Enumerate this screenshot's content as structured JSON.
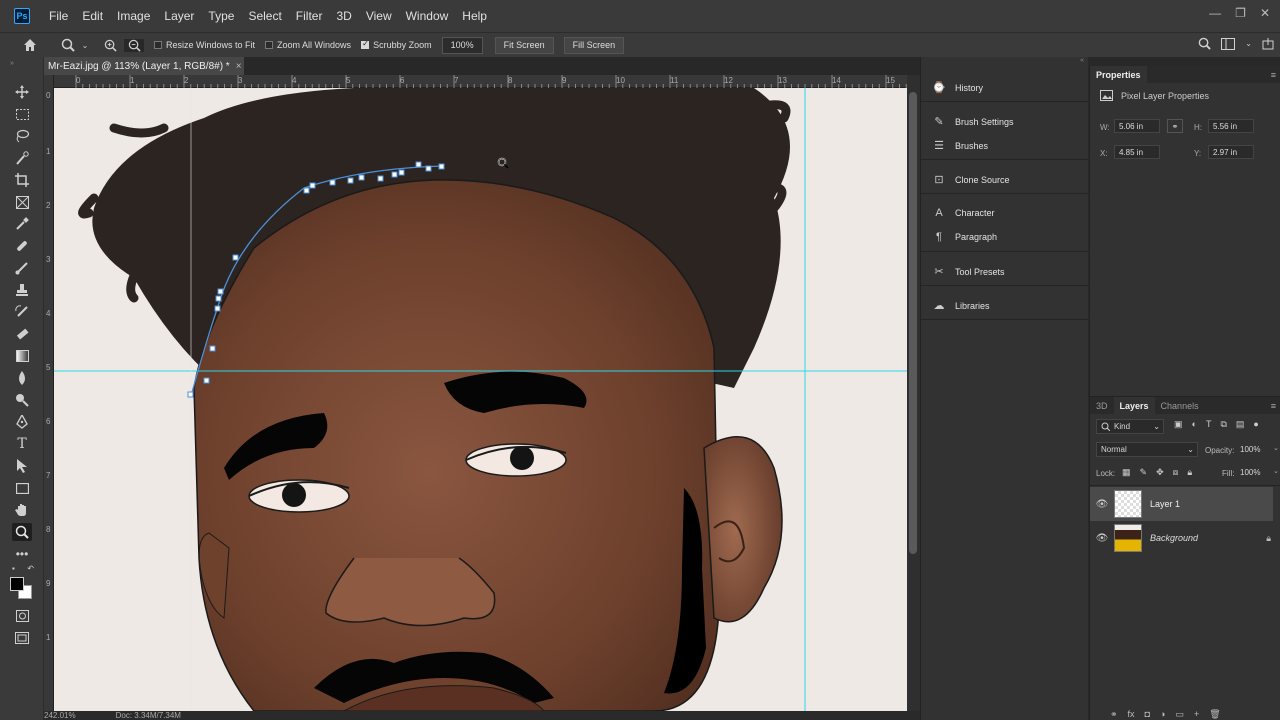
{
  "menu": {
    "logo": "Ps",
    "items": [
      "File",
      "Edit",
      "Image",
      "Layer",
      "Type",
      "Select",
      "Filter",
      "3D",
      "View",
      "Window",
      "Help"
    ],
    "window_controls": [
      "—",
      "❐",
      "✕"
    ]
  },
  "options": {
    "resize_windows_label": "Resize Windows to Fit",
    "resize_windows_checked": false,
    "zoom_all_label": "Zoom All Windows",
    "zoom_all_checked": false,
    "scrubby_zoom_label": "Scrubby Zoom",
    "scrubby_zoom_checked": true,
    "zoom_value": "100%",
    "fit_screen_label": "Fit Screen",
    "fill_screen_label": "Fill Screen"
  },
  "document": {
    "tab_title": "Mr-Eazi.jpg @ 113% (Layer 1, RGB/8#) *",
    "tab_close": "×",
    "h_ruler_labels": [
      "0",
      "1",
      "2",
      "3",
      "4",
      "5",
      "6",
      "7",
      "8",
      "9",
      "10",
      "11",
      "12",
      "13",
      "14",
      "15"
    ],
    "v_ruler_labels": [
      "0",
      "1",
      "2",
      "3",
      "4",
      "5",
      "6",
      "7",
      "8",
      "9",
      "1"
    ],
    "zoom_status": "242.01%",
    "doc_status": "Doc: 3.34M/7.34M"
  },
  "collapsed_panels": [
    {
      "icon": "history-icon",
      "glyph": "⌚",
      "label": "History"
    },
    {
      "icon": "brush-settings-icon",
      "glyph": "✎",
      "label": "Brush Settings"
    },
    {
      "icon": "brushes-icon",
      "glyph": "☰",
      "label": "Brushes"
    },
    {
      "icon": "clone-source-icon",
      "glyph": "⊡",
      "label": "Clone Source"
    },
    {
      "icon": "character-icon",
      "glyph": "A",
      "label": "Character"
    },
    {
      "icon": "paragraph-icon",
      "glyph": "¶",
      "label": "Paragraph"
    },
    {
      "icon": "tool-presets-icon",
      "glyph": "✂",
      "label": "Tool Presets"
    },
    {
      "icon": "libraries-icon",
      "glyph": "☁",
      "label": "Libraries"
    }
  ],
  "properties": {
    "tab": "Properties",
    "section": "Pixel Layer Properties",
    "w_label": "W:",
    "w_value": "5.06 in",
    "h_label": "H:",
    "h_value": "5.56 in",
    "x_label": "X:",
    "x_value": "4.85 in",
    "y_label": "Y:",
    "y_value": "2.97 in"
  },
  "layers_panel": {
    "tabs": [
      "3D",
      "Layers",
      "Channels"
    ],
    "active_tab": "Layers",
    "filter": "Kind",
    "blend_mode": "Normal",
    "opacity_label": "Opacity:",
    "opacity_value": "100%",
    "lock_label": "Lock:",
    "fill_label": "Fill:",
    "fill_value": "100%",
    "layers": [
      {
        "name": "Layer 1",
        "selected": true,
        "locked": false
      },
      {
        "name": "Background",
        "selected": false,
        "locked": true
      }
    ],
    "bottom_icons": [
      "⚭",
      "fx",
      "◘",
      "◑",
      "▭",
      "+",
      "🗑"
    ]
  },
  "colors": {
    "canvas_bg": "#efe9e5",
    "skin": "#7a4a34",
    "hair": "#2b2420",
    "guide": "#29d6e6",
    "path": "#4d8fd8",
    "accent": "#31a8ff"
  }
}
